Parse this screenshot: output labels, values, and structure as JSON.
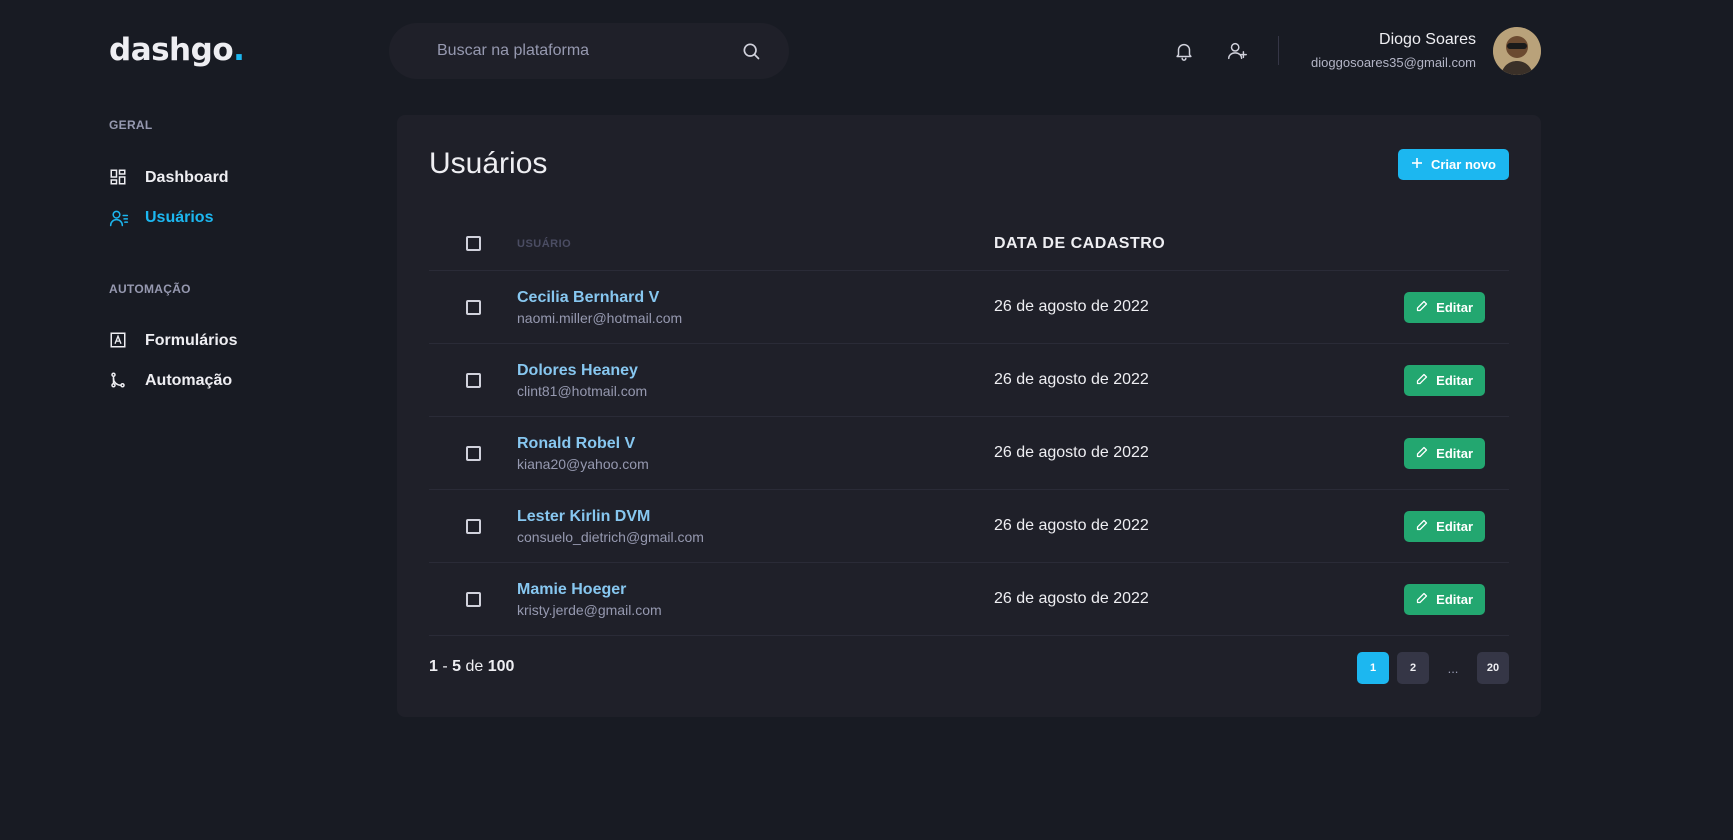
{
  "header": {
    "logo_text": "dashgo",
    "logo_dot": ".",
    "search_placeholder": "Buscar na plataforma",
    "profile": {
      "name": "Diogo Soares",
      "email": "dioggosoares35@gmail.com"
    }
  },
  "sidebar": {
    "sections": [
      {
        "title": "GERAL",
        "items": [
          {
            "label": "Dashboard",
            "icon": "dashboard-icon",
            "active": false
          },
          {
            "label": "Usuários",
            "icon": "users-icon",
            "active": true
          }
        ]
      },
      {
        "title": "AUTOMAÇÃO",
        "items": [
          {
            "label": "Formulários",
            "icon": "form-icon",
            "active": false
          },
          {
            "label": "Automação",
            "icon": "git-branch-icon",
            "active": false
          }
        ]
      }
    ]
  },
  "main": {
    "title": "Usuários",
    "create_button": "Criar novo",
    "table": {
      "headers": {
        "user": "USUÁRIO",
        "date": "DATA DE CADASTRO"
      },
      "edit_label": "Editar",
      "rows": [
        {
          "name": "Cecilia Bernhard V",
          "email": "naomi.miller@hotmail.com",
          "date": "26 de agosto de 2022"
        },
        {
          "name": "Dolores Heaney",
          "email": "clint81@hotmail.com",
          "date": "26 de agosto de 2022"
        },
        {
          "name": "Ronald Robel V",
          "email": "kiana20@yahoo.com",
          "date": "26 de agosto de 2022"
        },
        {
          "name": "Lester Kirlin DVM",
          "email": "consuelo_dietrich@gmail.com",
          "date": "26 de agosto de 2022"
        },
        {
          "name": "Mamie Hoeger",
          "email": "kristy.jerde@gmail.com",
          "date": "26 de agosto de 2022"
        }
      ]
    },
    "pagination_info": {
      "from": "1",
      "to": "5",
      "of_label": "de",
      "total": "100"
    },
    "pagination": {
      "pages": [
        "1",
        "2",
        "20"
      ],
      "ellipsis": "...",
      "active": "1"
    }
  },
  "colors": {
    "background": "#181b23",
    "surface": "#1f2029",
    "accent": "#1cb7f0",
    "edit_green": "#23a770",
    "user_name": "#87c7f0"
  }
}
